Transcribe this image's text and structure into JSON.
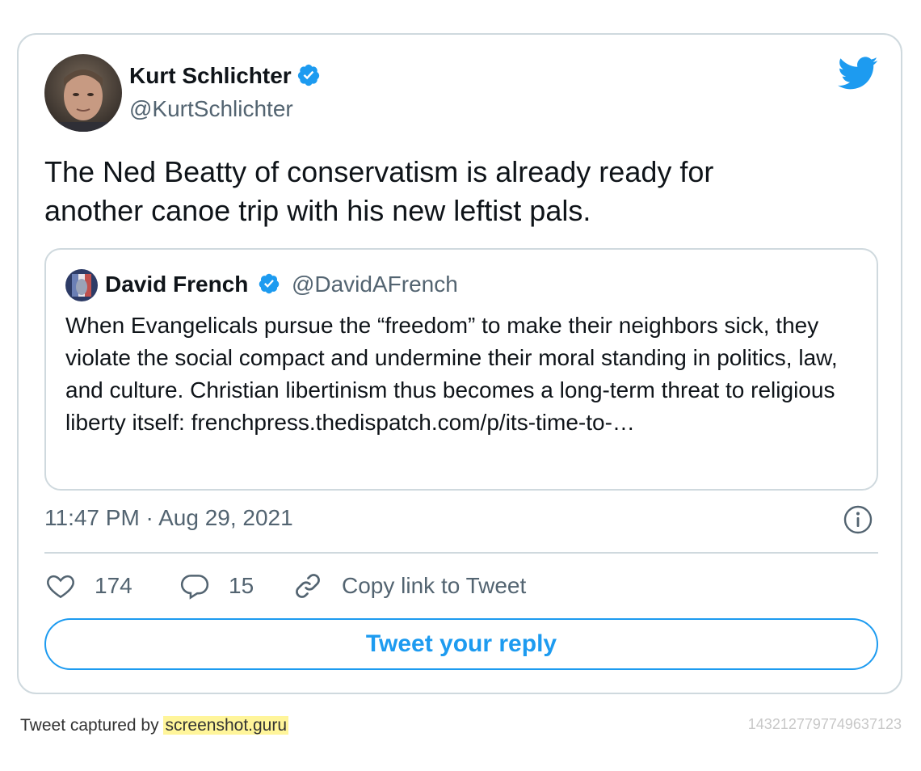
{
  "tweet": {
    "author_name": "Kurt Schlichter",
    "author_handle": "@KurtSchlichter",
    "text": "The Ned Beatty of conservatism is already ready for\nanother canoe trip with his new leftist pals.",
    "timestamp": "11:47 PM · Aug 29, 2021",
    "likes": "174",
    "replies": "15",
    "copy_link_label": "Copy link to Tweet",
    "reply_button_label": "Tweet your reply"
  },
  "quoted_tweet": {
    "author_name": "David French",
    "author_handle": "@DavidAFrench",
    "text": "When Evangelicals pursue the “freedom” to make their neighbors sick, they violate the social compact and undermine their moral standing in politics, law, and culture. Christian libertinism thus becomes a long-term threat to religious liberty itself: frenchpress.thedispatch.com/p/its-time-to-…"
  },
  "footer": {
    "captured_by_prefix": "Tweet captured by ",
    "captured_by_brand": "screenshot.guru",
    "tweet_id": "1432127797749637123"
  },
  "icons": {
    "verified": "verified-badge-icon",
    "brand": "twitter-bird-icon",
    "info": "info-icon",
    "like": "heart-icon",
    "reply": "speech-bubble-icon",
    "link": "link-icon"
  },
  "colors": {
    "accent": "#1d9bf0",
    "text": "#0f1419",
    "secondary_text": "#536471",
    "border": "#cfd9de",
    "highlight": "#fff59a"
  }
}
